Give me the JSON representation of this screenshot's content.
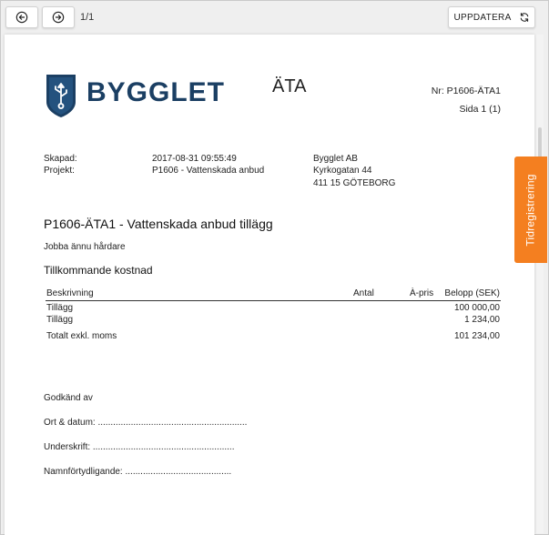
{
  "toolbar": {
    "page_indicator": "1/1",
    "refresh_label": "UPPDATERA"
  },
  "document": {
    "logo_text": "BYGGLET",
    "doc_type": "ÄTA",
    "doc_number": "Nr: P1606-ÄTA1",
    "page": "Sida 1 (1)",
    "meta": {
      "created_label": "Skapad:",
      "created_value": "2017-08-31 09:55:49",
      "project_label": "Projekt:",
      "project_value": "P1606 - Vattenskada anbud"
    },
    "company": {
      "name": "Bygglet AB",
      "street": "Kyrkogatan 44",
      "city": "411 15 GÖTEBORG"
    },
    "title": "P1606-ÄTA1 - Vattenskada anbud tillägg",
    "description": "Jobba ännu hårdare",
    "section_title": "Tillkommande kostnad",
    "table": {
      "headers": {
        "desc": "Beskrivning",
        "antal": "Antal",
        "apris": "À-pris",
        "belopp": "Belopp (SEK)"
      },
      "rows": [
        {
          "desc": "Tillägg",
          "belopp": "100 000,00"
        },
        {
          "desc": "Tillägg",
          "belopp": "1 234,00"
        }
      ],
      "total_label": "Totalt exkl. moms",
      "total_value": "101 234,00"
    },
    "approval": {
      "heading": "Godkänd av",
      "place_date": "Ort & datum: ...........................................................",
      "signature": "Underskrift: ........................................................",
      "name_clarification": "Namnförtydligande: .........................................."
    }
  },
  "side_tab": {
    "label": "Tidregistrering"
  },
  "colors": {
    "brand_navy": "#1b3f63",
    "accent_orange": "#f47f20"
  },
  "icons": {
    "prev": "arrow-left-circle-icon",
    "next": "arrow-right-circle-icon",
    "refresh": "refresh-icon",
    "logo": "usb-shield-logo-icon"
  }
}
